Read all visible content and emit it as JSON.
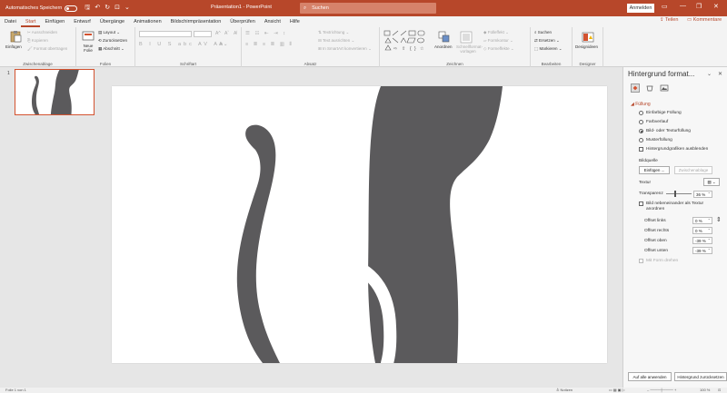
{
  "titlebar": {
    "autosave_label": "Automatisches Speichern",
    "doc_title": "Präsentation1 - PowerPoint",
    "search_placeholder": "Suchen",
    "signin_label": "Anmelden"
  },
  "tabs": [
    "Datei",
    "Start",
    "Einfügen",
    "Entwurf",
    "Übergänge",
    "Animationen",
    "Bildschirmpräsentation",
    "Überprüfen",
    "Ansicht",
    "Hilfe"
  ],
  "active_tab": "Start",
  "share_label": "Teilen",
  "comments_label": "Kommentare",
  "ribbon": {
    "clipboard": {
      "label": "Zwischenablage",
      "paste": "Einfügen",
      "cut": "Ausschneiden",
      "copy": "Kopieren",
      "format_painter": "Format übertragen"
    },
    "slides": {
      "label": "Folien",
      "new_slide": "Neue Folie",
      "layout": "Layout",
      "reset": "Zurücksetzen",
      "section": "Abschnitt"
    },
    "font": {
      "label": "Schriftart"
    },
    "paragraph": {
      "label": "Absatz",
      "text_direction": "Textrichtung",
      "align_text": "Text ausrichten",
      "smartart": "In SmartArt konvertieren"
    },
    "drawing": {
      "label": "Zeichnen",
      "arrange": "Anordnen",
      "quick_styles": "Schnellformat-vorlagen",
      "fill": "Fülleffekt",
      "outline": "Formkontur",
      "effects": "Formeffekte"
    },
    "editing": {
      "label": "Bearbeiten",
      "find": "Suchen",
      "replace": "Ersetzen",
      "select": "Markieren"
    },
    "designer": {
      "label": "Designer",
      "ideas": "Designideen"
    }
  },
  "thumbnail": {
    "number": "1"
  },
  "panel": {
    "title": "Hintergrund format...",
    "section": "Füllung",
    "options": [
      {
        "label": "Einfarbige Füllung",
        "selected": false
      },
      {
        "label": "Farbverlauf",
        "selected": false
      },
      {
        "label": "Bild- oder Texturfüllung",
        "selected": true
      },
      {
        "label": "Musterfüllung",
        "selected": false
      }
    ],
    "hide_graphics": "Hintergrundgrafiken ausblenden",
    "image_source": "Bildquelle",
    "insert_button": "Einfügen ...",
    "clipboard_button": "Zwischenablage",
    "texture_label": "Textur",
    "transparency_label": "Transparenz",
    "transparency_value": "36 %",
    "transparency": 0.36,
    "tile_label": "Bild nebeneinander als Textur anordnen",
    "offsets": [
      {
        "label": "Offset links",
        "value": "0 %"
      },
      {
        "label": "Offset rechts",
        "value": "0 %"
      },
      {
        "label": "Offset oben",
        "value": "-39 %"
      },
      {
        "label": "Offset unten",
        "value": "-39 %"
      }
    ],
    "rotate_with_shape": "Mit Form drehen",
    "apply_all": "Auf alle anwenden",
    "reset_bg": "Hintergrund zurücksetzen"
  },
  "statusbar": {
    "slide_info": "Folie 1 von 1",
    "notes": "Notizen",
    "zoom": "100 %"
  },
  "colors": {
    "accent": "#b7472a",
    "cat": "#5b5a5c"
  }
}
